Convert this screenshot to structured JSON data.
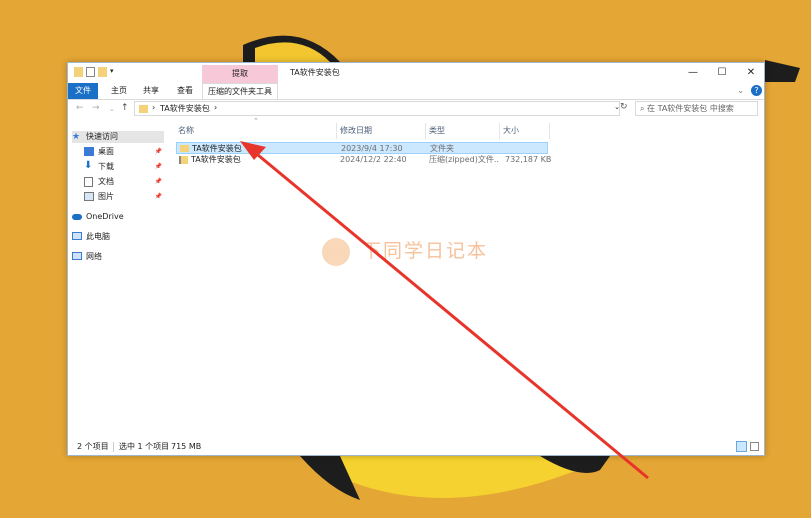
{
  "window": {
    "title": "TA软件安装包",
    "context_tab": "提取",
    "controls": {
      "minimize": "—",
      "maximize": "☐",
      "close": "✕"
    }
  },
  "ribbon": {
    "tabs": [
      "文件",
      "主页",
      "共享",
      "查看",
      "压缩的文件夹工具"
    ]
  },
  "address": {
    "path_root": "›",
    "path": "TA软件安装包",
    "path_sep": "›",
    "search_placeholder": "在 TA软件安装包 中搜索"
  },
  "sidebar": {
    "items": [
      {
        "label": "快速访问",
        "icon": "star-icon",
        "pinned": false
      },
      {
        "label": "桌面",
        "icon": "desktop-icon",
        "pinned": true
      },
      {
        "label": "下载",
        "icon": "download-icon",
        "pinned": true
      },
      {
        "label": "文档",
        "icon": "document-icon",
        "pinned": true
      },
      {
        "label": "图片",
        "icon": "picture-icon",
        "pinned": true
      },
      {
        "label": "OneDrive",
        "icon": "cloud-icon",
        "pinned": false
      },
      {
        "label": "此电脑",
        "icon": "computer-icon",
        "pinned": false
      },
      {
        "label": "网络",
        "icon": "network-icon",
        "pinned": false
      }
    ]
  },
  "columns": {
    "name": "名称",
    "date": "修改日期",
    "type": "类型",
    "size": "大小"
  },
  "files": [
    {
      "name": "TA软件安装包",
      "date": "2023/9/4 17:30",
      "type": "文件夹",
      "size": "",
      "icon": "folder-icon",
      "selected": true
    },
    {
      "name": "TA软件安装包",
      "date": "2024/12/2 22:40",
      "type": "压缩(zipped)文件...",
      "size": "732,187 KB",
      "icon": "zip-folder-icon",
      "selected": false
    }
  ],
  "status": {
    "count": "2 个项目",
    "selected": "选中 1 个项目",
    "size": "715 MB"
  },
  "watermark": "下同学日记本",
  "colors": {
    "accent": "#1a6fc6",
    "selection": "#cce8ff",
    "arrow": "#e8352b",
    "background": "#e4a634"
  }
}
